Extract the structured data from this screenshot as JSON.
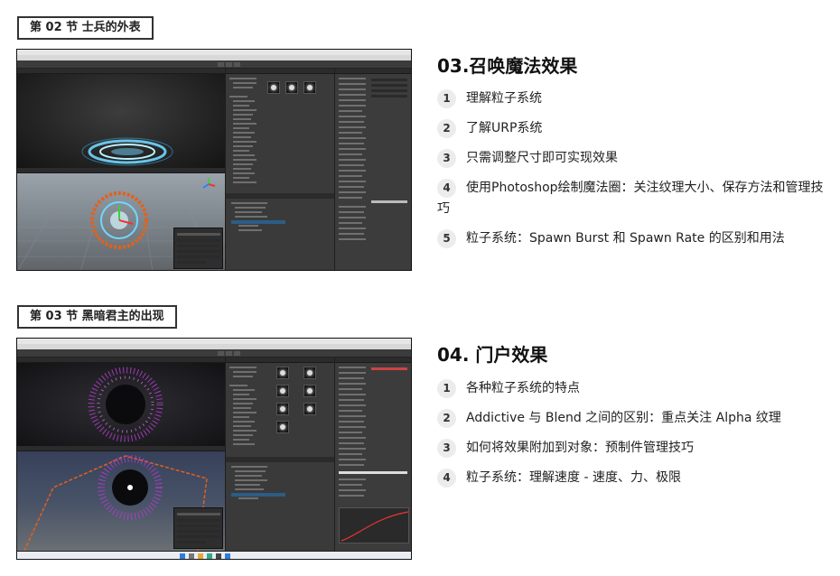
{
  "sections": [
    {
      "tag": "第 02 节 士兵的外表",
      "title": "03.召唤魔法效果",
      "items": [
        {
          "num": "1",
          "text": "理解粒子系统"
        },
        {
          "num": "2",
          "text": "了解URP系统"
        },
        {
          "num": "3",
          "text": "只需调整尺寸即可实现效果"
        },
        {
          "num": "4",
          "text": "使用Photoshop绘制魔法圈：关注纹理大小、保存方法和管理技巧"
        },
        {
          "num": "5",
          "text": "粒子系统：Spawn Burst 和 Spawn Rate 的区别和用法"
        }
      ]
    },
    {
      "tag": "第 03 节 黑暗君主的出现",
      "title": "04. 门户效果",
      "items": [
        {
          "num": "1",
          "text": "各种粒子系统的特点"
        },
        {
          "num": "2",
          "text": "Addictive 与 Blend 之间的区别：重点关注 Alpha 纹理"
        },
        {
          "num": "3",
          "text": "如何将效果附加到对象：预制件管理技巧"
        },
        {
          "num": "4",
          "text": "粒子系统：理解速度 - 速度、力、极限"
        }
      ]
    }
  ],
  "icons": {
    "scene_gizmo": "axis-gizmo-icon",
    "magic_circle": "magic-circle-icon",
    "portal": "portal-icon"
  },
  "colors": {
    "accent_orange": "#e2611c",
    "glow_blue": "#6fd6ff",
    "portal_purple": "#b73dcf",
    "unity_panel": "#383838",
    "badge_bg": "#ececec"
  }
}
